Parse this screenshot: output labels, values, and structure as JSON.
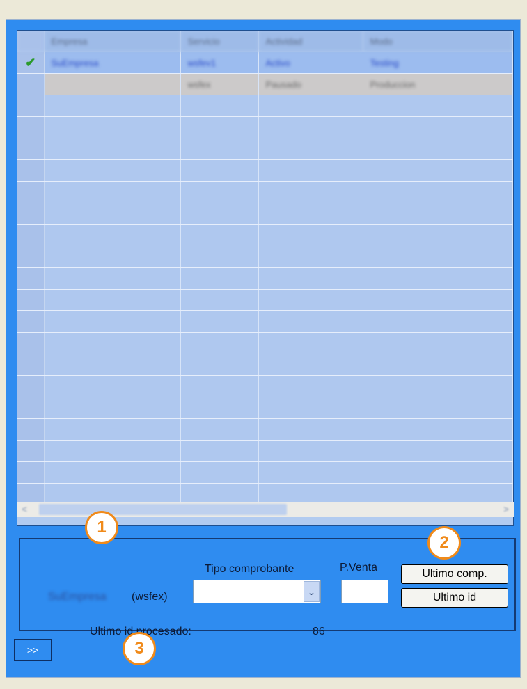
{
  "grid": {
    "columns": [
      "Empresa",
      "Servicio",
      "Actividad",
      "Modo"
    ],
    "rows": [
      {
        "check": "✔",
        "empresa": "SuEmpresa",
        "servicio": "wsfev1",
        "actividad": "Activo",
        "modo": "Testing"
      },
      {
        "check": "",
        "empresa": "",
        "servicio": "wsfex",
        "actividad": "Pausado",
        "modo": "Produccion"
      }
    ]
  },
  "scrollbar": {
    "left_arrow": "<",
    "right_arrow": ">"
  },
  "form": {
    "company_label": "SuEmpresa",
    "service_label": "(wsfex)",
    "tipo_label": "Tipo comprobante",
    "pventa_label": "P.Venta",
    "ultimo_comp_label": "Ultimo comp.",
    "ultimo_id_label": "Ultimo id",
    "ultimo_procesado_label": "Ultimo id procesado:",
    "ultimo_procesado_value": "86",
    "tipo_selected": "",
    "pventa_value": ""
  },
  "badges": [
    "1",
    "2",
    "3"
  ],
  "expand_button": ">>",
  "colors": {
    "accent": "#2f8cf0",
    "badge": "#f08a1a"
  }
}
